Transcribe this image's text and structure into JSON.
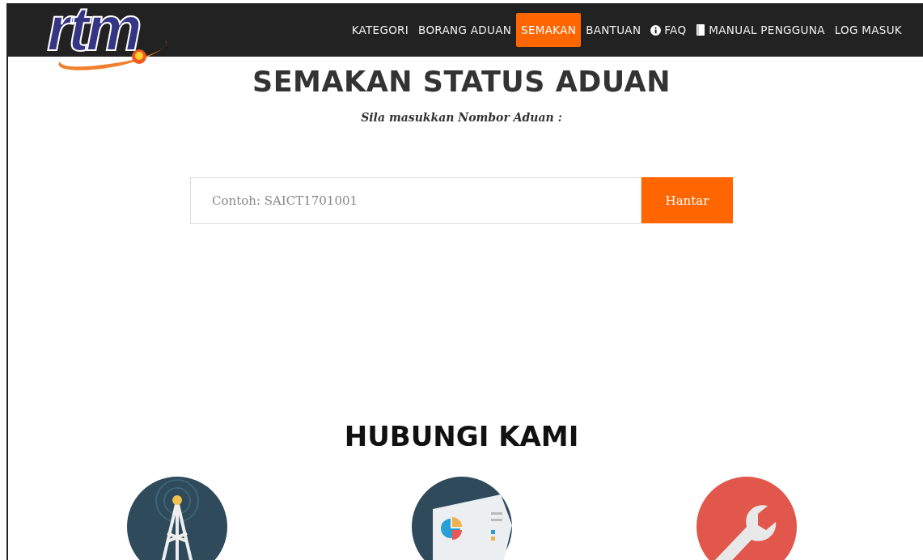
{
  "logo": {
    "text": "rtm"
  },
  "nav": [
    {
      "label": "KATEGORI",
      "kind": "plain",
      "selected": false
    },
    {
      "label": "BORANG ADUAN",
      "kind": "plain",
      "selected": false
    },
    {
      "label": "SEMAKAN",
      "kind": "plain",
      "selected": true
    },
    {
      "label": "BANTUAN",
      "kind": "plain",
      "selected": false
    },
    {
      "label": "FAQ",
      "kind": "info",
      "selected": false
    },
    {
      "label": "MANUAL PENGGUNA",
      "kind": "book",
      "selected": false
    },
    {
      "label": "LOG MASUK",
      "kind": "plain",
      "selected": false
    }
  ],
  "heading": "SEMAKAN STATUS ADUAN",
  "prompt": "Sila masukkan Nombor Aduan :",
  "search": {
    "placeholder": "Contoh: SAICT1701001",
    "button": "Hantar"
  },
  "contact": {
    "heading": "HUBUNGI KAMI",
    "items": [
      {
        "kind": "tower"
      },
      {
        "kind": "presentation"
      },
      {
        "kind": "wrench"
      }
    ]
  }
}
